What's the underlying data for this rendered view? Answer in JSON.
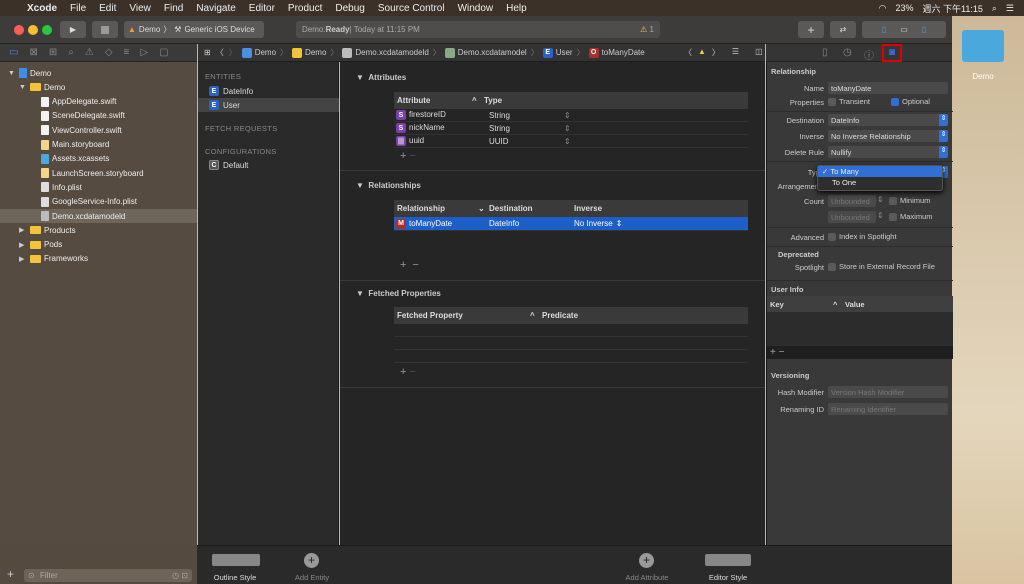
{
  "menubar": {
    "app": "Xcode",
    "items": [
      "File",
      "Edit",
      "View",
      "Find",
      "Navigate",
      "Editor",
      "Product",
      "Debug",
      "Source Control",
      "Window",
      "Help"
    ],
    "battery": "23%",
    "clock": "週六 下午11:15"
  },
  "toolbar": {
    "scheme": "Demo",
    "device": "Generic iOS Device",
    "status_prefix": "Demo: ",
    "status_state": "Ready",
    "status_time": " | Today at 11:15 PM",
    "warning_count": "1"
  },
  "navigator": {
    "tree": [
      {
        "label": "Demo",
        "depth": 0,
        "icon": "project-icon",
        "open": true
      },
      {
        "label": "Demo",
        "depth": 1,
        "icon": "folder-icon",
        "open": true
      },
      {
        "label": "AppDelegate.swift",
        "depth": 2,
        "icon": "swift-file-icon"
      },
      {
        "label": "SceneDelegate.swift",
        "depth": 2,
        "icon": "swift-file-icon"
      },
      {
        "label": "ViewController.swift",
        "depth": 2,
        "icon": "swift-file-icon"
      },
      {
        "label": "Main.storyboard",
        "depth": 2,
        "icon": "storyboard-icon"
      },
      {
        "label": "Assets.xcassets",
        "depth": 2,
        "icon": "assets-icon"
      },
      {
        "label": "LaunchScreen.storyboard",
        "depth": 2,
        "icon": "storyboard-icon"
      },
      {
        "label": "Info.plist",
        "depth": 2,
        "icon": "plist-icon"
      },
      {
        "label": "GoogleService-Info.plist",
        "depth": 2,
        "icon": "plist-icon"
      },
      {
        "label": "Demo.xcdatamodeld",
        "depth": 2,
        "icon": "datamodel-icon",
        "selected": true
      },
      {
        "label": "Products",
        "depth": 1,
        "icon": "folder-icon",
        "open": false
      },
      {
        "label": "Pods",
        "depth": 1,
        "icon": "folder-icon",
        "open": false
      },
      {
        "label": "Frameworks",
        "depth": 1,
        "icon": "folder-icon",
        "open": false
      }
    ],
    "filter_placeholder": "Filter"
  },
  "jumpbar": [
    "Demo",
    "Demo",
    "Demo.xcdatamodeld",
    "Demo.xcdatamodel",
    "User",
    "toManyDate"
  ],
  "entities": {
    "entities_header": "ENTITIES",
    "items": [
      "DateInfo",
      "User"
    ],
    "selected": "User",
    "fetch_header": "FETCH REQUESTS",
    "config_header": "CONFIGURATIONS",
    "configs": [
      "Default"
    ]
  },
  "editor": {
    "attributes": {
      "title": "Attributes",
      "headers": [
        "Attribute",
        "Type"
      ],
      "rows": [
        {
          "badge": "S",
          "name": "firestoreID",
          "type": "String"
        },
        {
          "badge": "S",
          "name": "nickName",
          "type": "String"
        },
        {
          "badge": "|||",
          "name": "uuid",
          "type": "UUID"
        }
      ]
    },
    "relationships": {
      "title": "Relationships",
      "headers": [
        "Relationship",
        "Destination",
        "Inverse"
      ],
      "rows": [
        {
          "badge": "M",
          "name": "toManyDate",
          "destination": "DateInfo",
          "inverse": "No Inverse"
        }
      ]
    },
    "fetched": {
      "title": "Fetched Properties",
      "headers": [
        "Fetched Property",
        "Predicate"
      ]
    }
  },
  "inspector": {
    "section": "Relationship",
    "name_label": "Name",
    "name": "toManyDate",
    "properties_label": "Properties",
    "transient": "Transient",
    "optional": "Optional",
    "destination_label": "Destination",
    "destination": "DateInfo",
    "inverse_label": "Inverse",
    "inverse": "No Inverse Relationship",
    "delete_rule_label": "Delete Rule",
    "delete_rule": "Nullify",
    "type_label": "Type",
    "arrangement_label": "Arrangement",
    "type_options": [
      "To Many",
      "To One"
    ],
    "type_selected": "To Many",
    "count_label": "Count",
    "unbounded": "Unbounded",
    "minimum": "Minimum",
    "maximum": "Maximum",
    "advanced_label": "Advanced",
    "index_spotlight": "Index in Spotlight",
    "deprecated": "Deprecated",
    "spotlight_label": "Spotlight",
    "store_external": "Store in External Record File",
    "user_info": "User Info",
    "key": "Key",
    "value": "Value",
    "versioning": "Versioning",
    "hash_label": "Hash Modifier",
    "hash_placeholder": "Version Hash Modifier",
    "renaming_label": "Renaming ID",
    "renaming_placeholder": "Renaming Identifier"
  },
  "bottombar": {
    "outline_style": "Outline Style",
    "add_entity": "Add Entity",
    "add_attribute": "Add Attribute",
    "editor_style": "Editor Style"
  },
  "desktop": {
    "folder": "Demo"
  },
  "colors": {
    "accent": "#2f6fd6",
    "highlight_box": "#e00000"
  }
}
